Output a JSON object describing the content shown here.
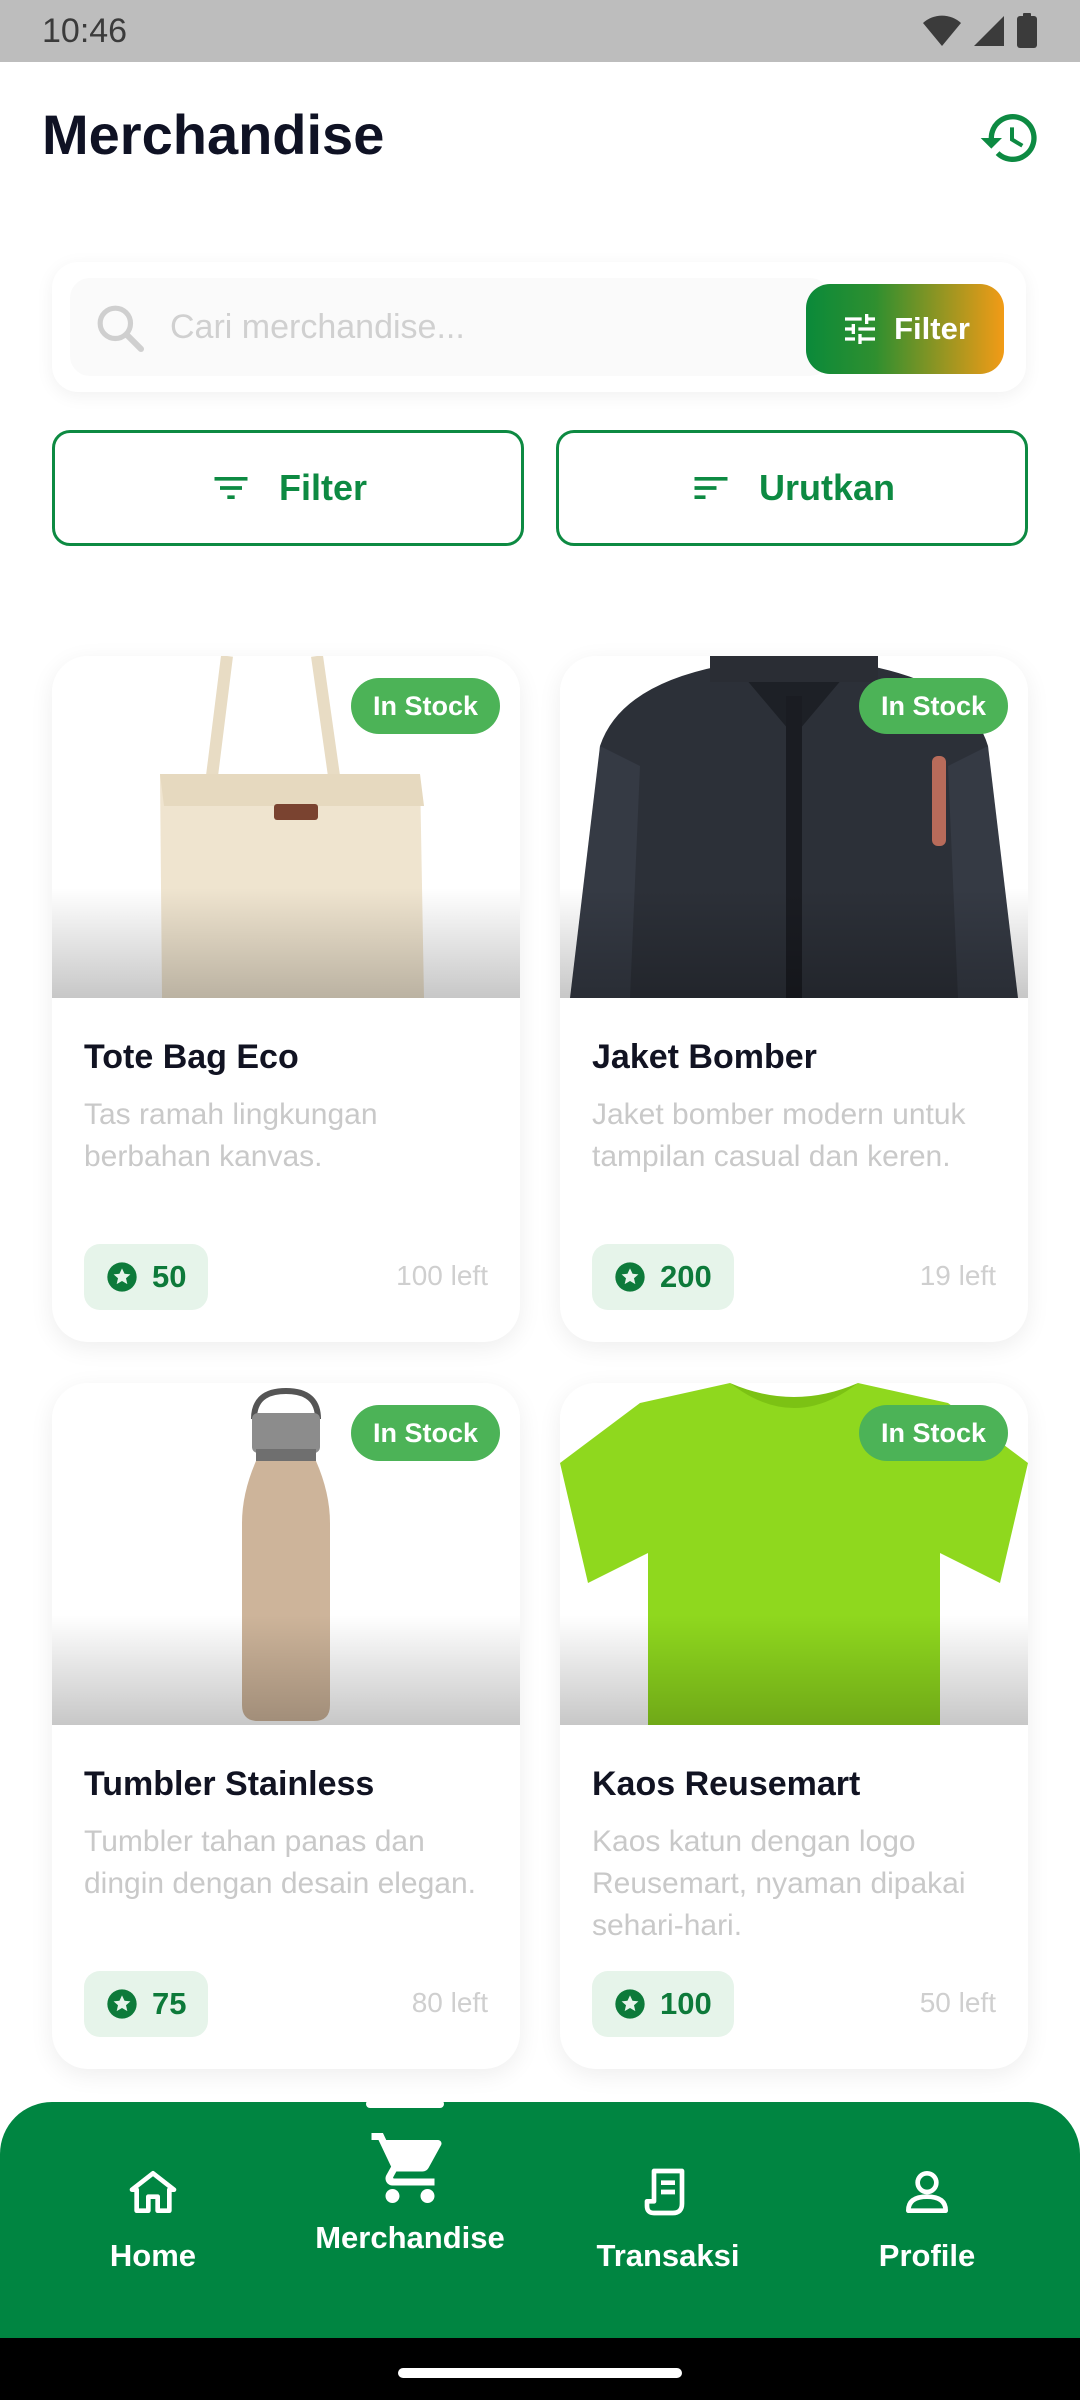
{
  "status_bar": {
    "time": "10:46",
    "icons": [
      "wifi-icon",
      "signal-icon",
      "battery-icon"
    ]
  },
  "header": {
    "title": "Merchandise",
    "history_icon": "history-icon"
  },
  "search": {
    "placeholder": "Cari merchandise...",
    "value": "",
    "filter_button_label": "Filter"
  },
  "controls": {
    "filter_label": "Filter",
    "sort_label": "Urutkan"
  },
  "products": [
    {
      "name": "Tote Bag Eco",
      "description": "Tas ramah lingkungan berbahan kanvas.",
      "stock_status": "In Stock",
      "points": "50",
      "stock_left": "100 left"
    },
    {
      "name": "Jaket Bomber",
      "description": "Jaket bomber modern untuk tampilan casual dan keren.",
      "stock_status": "In Stock",
      "points": "200",
      "stock_left": "19 left"
    },
    {
      "name": "Tumbler Stainless",
      "description": "Tumbler tahan panas dan dingin dengan desain elegan.",
      "stock_status": "In Stock",
      "points": "75",
      "stock_left": "80 left"
    },
    {
      "name": "Kaos Reusemart",
      "description": "Kaos katun dengan logo Reusemart, nyaman dipakai sehari-hari.",
      "stock_status": "In Stock",
      "points": "100",
      "stock_left": "50 left"
    }
  ],
  "bottom_nav": {
    "items": [
      {
        "label": "Home",
        "icon": "home-icon"
      },
      {
        "label": "Merchandise",
        "icon": "cart-icon",
        "active": true
      },
      {
        "label": "Transaksi",
        "icon": "receipt-icon"
      },
      {
        "label": "Profile",
        "icon": "person-icon"
      }
    ]
  },
  "colors": {
    "primary_green": "#008541",
    "accent_orange": "#f29b16",
    "badge_green": "#4cb357"
  }
}
